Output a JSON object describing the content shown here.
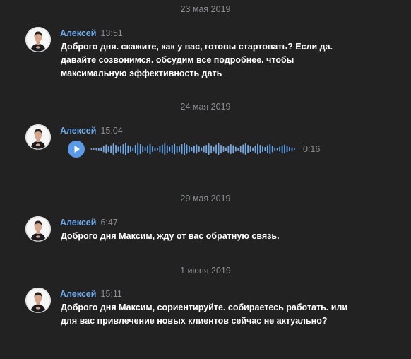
{
  "author": "Алексей",
  "colors": {
    "background": "#222222",
    "author": "#71aaeb",
    "secondary_text": "#8c8f93",
    "message_text": "#ffffff",
    "play_button": "#5b9ae6",
    "waveform": "#71aaeb"
  },
  "dates": [
    "23 мая 2019",
    "24 мая 2019",
    "29 мая 2019",
    "1 июня 2019"
  ],
  "messages": [
    {
      "author": "Алексей",
      "time": "13:51",
      "text": "Доброго дня. скажите, как у вас, готовы стартовать? Если да.\nдавайте созвонимся. обсудим все подробнее. чтобы\nмаксимальную эффективность дать"
    },
    {
      "author": "Алексей",
      "time": "15:04",
      "voice": {
        "icon": "play-icon",
        "duration": "0:16"
      }
    },
    {
      "author": "Алексей",
      "time": "6:47",
      "text": "Доброго дня Максим, жду от вас обратную связь."
    },
    {
      "author": "Алексей",
      "time": "15:11",
      "text": "Доброго дня Максим, сориентируйте. собираетесь работать. или\nдля вас привлечение новых клиентов сейчас не актуально?"
    }
  ]
}
